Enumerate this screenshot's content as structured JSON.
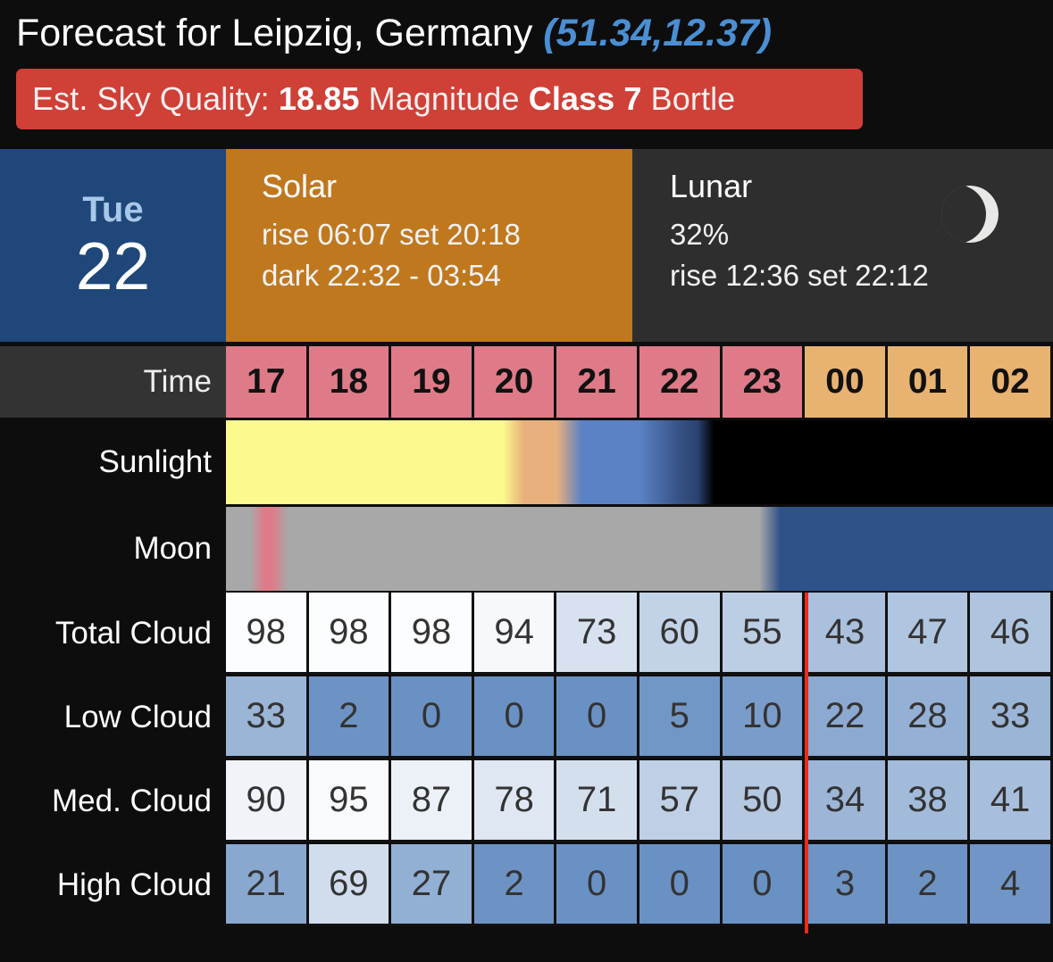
{
  "header": {
    "title_prefix": "Forecast for Leipzig, Germany",
    "coordinates": "(51.34,12.37)",
    "sky_quality_label": "Est. Sky Quality:",
    "sky_quality_value": "18.85",
    "sky_quality_unit": "Magnitude",
    "bortle_label": "Class 7",
    "bortle_unit": "Bortle",
    "banner_color": "#cf4037",
    "coords_color": "#4a8fd4"
  },
  "day": {
    "weekday": "Tue",
    "day_number": "22",
    "date_bg": "#1f4779",
    "solar": {
      "heading": "Solar",
      "riseset": "rise 06:07 set 20:18",
      "dark": "dark 22:32 - 03:54",
      "bg": "#c0781f"
    },
    "lunar": {
      "heading": "Lunar",
      "illumination": "32%",
      "riseset": "rise 12:36 set 22:12",
      "phase_icon": "waxing-crescent-moon-icon",
      "bg": "#2e2e2e"
    }
  },
  "grid": {
    "time_label": "Time",
    "sunlight_label": "Sunlight",
    "moon_label": "Moon",
    "hours": [
      "17",
      "18",
      "19",
      "20",
      "21",
      "22",
      "23",
      "00",
      "01",
      "02"
    ],
    "hour_kinds": [
      "pink",
      "pink",
      "pink",
      "pink",
      "pink",
      "pink",
      "pink",
      "tan",
      "tan",
      "tan"
    ],
    "midnight_marker_color": "#ee2a16",
    "rows": [
      {
        "label": "Total Cloud",
        "values": [
          98,
          98,
          98,
          94,
          73,
          60,
          55,
          43,
          47,
          46
        ]
      },
      {
        "label": "Low Cloud",
        "values": [
          33,
          2,
          0,
          0,
          0,
          5,
          10,
          22,
          28,
          33
        ]
      },
      {
        "label": "Med. Cloud",
        "values": [
          90,
          95,
          87,
          78,
          71,
          57,
          50,
          34,
          38,
          41
        ]
      },
      {
        "label": "High Cloud",
        "values": [
          21,
          69,
          27,
          2,
          0,
          0,
          0,
          3,
          2,
          4
        ]
      }
    ]
  },
  "chart_data": {
    "type": "heatmap",
    "title": "Forecast for Leipzig, Germany (51.34,12.37)",
    "xlabel": "Time",
    "ylabel": "",
    "categories": [
      "17",
      "18",
      "19",
      "20",
      "21",
      "22",
      "23",
      "00",
      "01",
      "02"
    ],
    "series": [
      {
        "name": "Total Cloud",
        "values": [
          98,
          98,
          98,
          94,
          73,
          60,
          55,
          43,
          47,
          46
        ]
      },
      {
        "name": "Low Cloud",
        "values": [
          33,
          2,
          0,
          0,
          0,
          5,
          10,
          22,
          28,
          33
        ]
      },
      {
        "name": "Med. Cloud",
        "values": [
          90,
          95,
          87,
          78,
          71,
          57,
          50,
          34,
          38,
          41
        ]
      },
      {
        "name": "High Cloud",
        "values": [
          21,
          69,
          27,
          2,
          0,
          0,
          0,
          3,
          2,
          4
        ]
      }
    ],
    "value_range": [
      0,
      100
    ],
    "units": "percent cloud cover",
    "grid": true,
    "legend": "none",
    "annotations": [
      "Sunlight band: daylight (yellow) through 20:18, civil/nautical/astronomical twilight (orange to blue) to 22:32, then full dark (black)",
      "Moon band: moon above horizon (grey) until moonset 22:12, then moon down (dark blue)",
      "Red vertical line marks midnight between hour 23 and hour 00"
    ]
  }
}
